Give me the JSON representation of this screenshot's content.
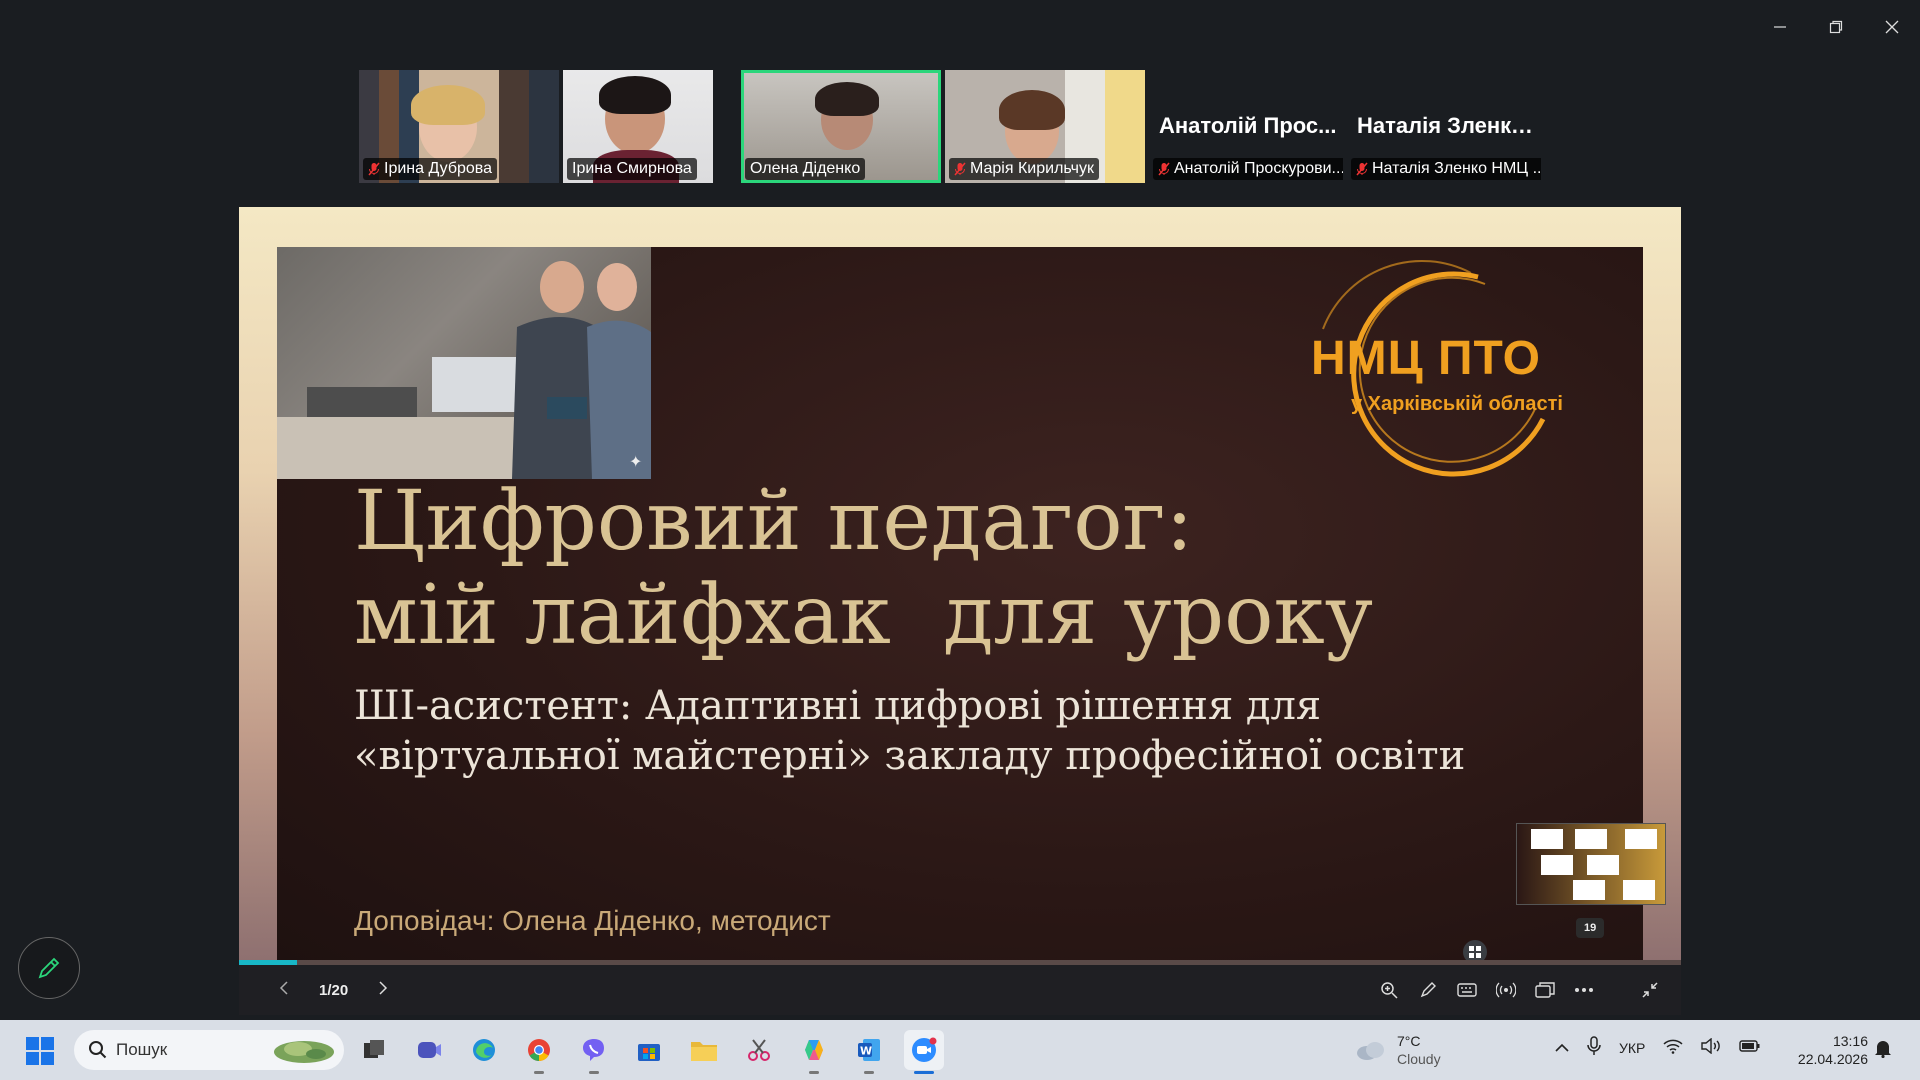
{
  "participants": [
    {
      "name": "Ірина Дуброва",
      "muted": true
    },
    {
      "name": "Ірина Смирнова",
      "muted": false
    },
    {
      "name": "Олена Діденко",
      "muted": true,
      "active_speaker": true
    },
    {
      "name": "Марія Кирильчук",
      "muted": true
    },
    {
      "name": "Анатолій Проскурови...",
      "display": "Анатолій Прос...",
      "muted": true
    },
    {
      "name": "Наталія Зленко НМЦ ...",
      "display": "Наталія Зленко...",
      "muted": true
    }
  ],
  "slide": {
    "logo_main": "НМЦ ПТО",
    "logo_sub": "у Харківській області",
    "title_line1": "Цифровий педагог:",
    "title_line2": "мій лайфхак  для уроку",
    "subtitle_line1": "ШІ-асистент: Адаптивні цифрові рішення для",
    "subtitle_line2": "«віртуальної майстерні» закладу професійної освіти",
    "speaker": "Доповідач: Олена Діденко, методист"
  },
  "player": {
    "page_label": "1/20",
    "progress": 0.04,
    "thumbnail_badge": "19"
  },
  "taskbar": {
    "search_placeholder": "Пошук",
    "weather_temp": "7°C",
    "weather_desc": "Cloudy",
    "language": "УКР",
    "time": "13:16",
    "date": "22.04.2026"
  },
  "colors": {
    "active_speaker": "#2bd67b",
    "progress": "#18b7c7",
    "slide_title": "#d9c394",
    "logo": "#f0a020"
  }
}
